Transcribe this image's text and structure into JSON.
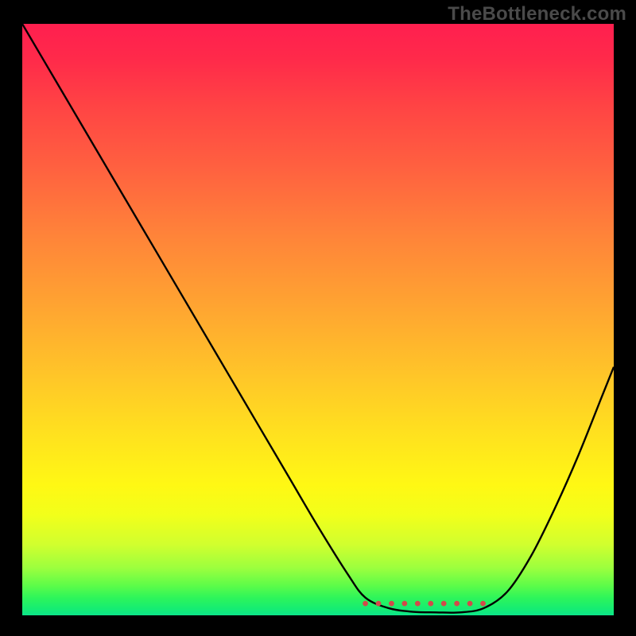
{
  "watermark": "TheBottleneck.com",
  "chart_data": {
    "type": "line",
    "title": "",
    "xlabel": "",
    "ylabel": "",
    "xlim": [
      0,
      100
    ],
    "ylim": [
      0,
      100
    ],
    "grid": false,
    "legend": false,
    "background_gradient": {
      "direction": "vertical",
      "stops": [
        {
          "pos": 0,
          "color": "#ff1f4f"
        },
        {
          "pos": 14,
          "color": "#ff4444"
        },
        {
          "pos": 36,
          "color": "#ff8439"
        },
        {
          "pos": 60,
          "color": "#ffc728"
        },
        {
          "pos": 78,
          "color": "#fff814"
        },
        {
          "pos": 92,
          "color": "#9cff3e"
        },
        {
          "pos": 100,
          "color": "#0de58a"
        }
      ]
    },
    "series": [
      {
        "name": "bottleneck-curve",
        "color": "#000000",
        "x": [
          0,
          5,
          10,
          15,
          20,
          25,
          30,
          35,
          40,
          45,
          50,
          55,
          58,
          62,
          66,
          70,
          74,
          78,
          82,
          86,
          90,
          94,
          98,
          100
        ],
        "y": [
          100,
          91.5,
          83,
          74.5,
          66,
          57.5,
          49,
          40.5,
          32,
          23.5,
          15,
          7,
          3,
          1.2,
          0.6,
          0.5,
          0.5,
          1.2,
          4,
          10,
          18,
          27,
          37,
          42
        ]
      },
      {
        "name": "optimal-range-marker",
        "color": "#d24a4a",
        "style": "dotted",
        "x": [
          58,
          78
        ],
        "y": [
          2,
          2
        ]
      }
    ],
    "notes": "V-shaped performance/bottleneck curve over a heat gradient background. No axis tick labels are present; x and y values are estimated on a 0–100 normalized scale from the image geometry."
  }
}
